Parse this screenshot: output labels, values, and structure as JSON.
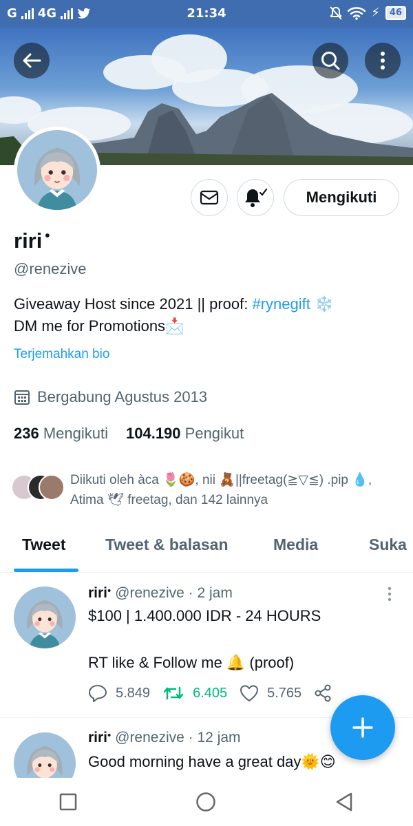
{
  "status_bar": {
    "network": "G",
    "network2": "4G",
    "time": "21:34",
    "battery": "46"
  },
  "profile": {
    "name": "riri",
    "name_dot": "•",
    "handle": "@renezive",
    "bio_line1": "Giveaway Host since 2021 || proof: ",
    "bio_tag": "#rynegift",
    "bio_emoji1": "❄️",
    "bio_line2": "DM me for Promotions",
    "bio_emoji2": "📩",
    "translate_label": "Terjemahkan bio",
    "joined": "Bergabung Agustus 2013",
    "following_count": "236",
    "following_label": "Mengikuti",
    "followers_count": "104.190",
    "followers_label": "Pengikut",
    "follow_button": "Mengikuti",
    "followed_by": "Diikuti oleh àca 🌷🍪, nii 🧸||freetag(≧▽≦) .pip 💧, Atima 🕊 freetag, dan 142 lainnya"
  },
  "tabs": [
    "Tweet",
    "Tweet & balasan",
    "Media",
    "Suka"
  ],
  "tweets": [
    {
      "name": "riri",
      "dot": "•",
      "handle": "@renezive",
      "time": "· 2 jam",
      "text": "$100 | 1.400.000 IDR - 24 HOURS\n\nRT like & Follow me 🔔 (proof)",
      "replies": "5.849",
      "retweets": "6.405",
      "likes": "5.765"
    },
    {
      "name": "riri",
      "dot": "•",
      "handle": "@renezive",
      "time": "· 12 jam",
      "text": "Good morning have a great day🌞😊"
    }
  ],
  "colors": {
    "accent": "#1d9bf0",
    "retweet": "#00ba7c",
    "status_bar": "#3f6db0"
  },
  "icons": [
    "back-arrow-icon",
    "search-icon",
    "more-vertical-icon",
    "mail-icon",
    "bell-check-icon",
    "calendar-icon",
    "reply-icon",
    "retweet-icon",
    "heart-icon",
    "share-icon",
    "compose-plus-icon",
    "nav-square-icon",
    "nav-circle-icon",
    "nav-back-triangle-icon"
  ]
}
